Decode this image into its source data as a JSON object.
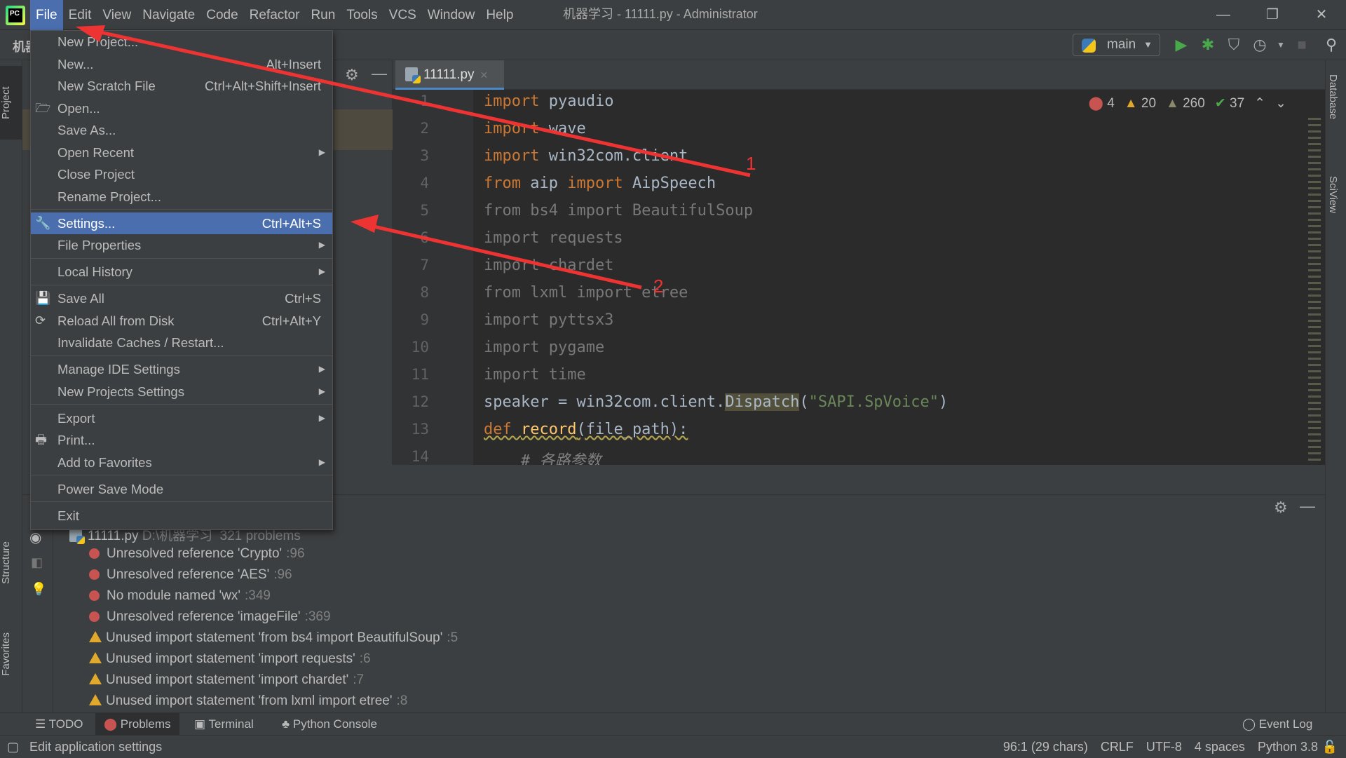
{
  "window": {
    "title": "机器学习 - 11111.py - Administrator",
    "minimize": "—",
    "restore": "❐",
    "close": "✕"
  },
  "menubar": [
    "File",
    "Edit",
    "View",
    "Navigate",
    "Code",
    "Refactor",
    "Run",
    "Tools",
    "VCS",
    "Window",
    "Help"
  ],
  "navbar": {
    "breadcrumb": "机器",
    "run_config": "main"
  },
  "left_tabs": {
    "project": "Project",
    "structure": "Structure",
    "favorites": "Favorites"
  },
  "right_tabs": {
    "database": "Database",
    "sciview": "SciView"
  },
  "editor": {
    "tab": "11111.py",
    "inspections": {
      "errors": "4",
      "warnings": "20",
      "weak_warnings": "260",
      "typos": "37"
    },
    "lines": [
      {
        "n": "1",
        "tokens": [
          {
            "t": "import ",
            "k": "kw"
          },
          {
            "t": "pyaudio",
            "k": "id"
          }
        ]
      },
      {
        "n": "2",
        "tokens": [
          {
            "t": "import ",
            "k": "kw"
          },
          {
            "t": "wave",
            "k": "id"
          }
        ]
      },
      {
        "n": "3",
        "tokens": [
          {
            "t": "import ",
            "k": "kw"
          },
          {
            "t": "win32com.client",
            "k": "id"
          }
        ]
      },
      {
        "n": "4",
        "tokens": [
          {
            "t": "from ",
            "k": "kw"
          },
          {
            "t": "aip ",
            "k": "id"
          },
          {
            "t": "import ",
            "k": "kw"
          },
          {
            "t": "AipSpeech",
            "k": "id"
          }
        ]
      },
      {
        "n": "5",
        "tokens": [
          {
            "t": "from bs4 import BeautifulSoup",
            "k": "dim"
          }
        ]
      },
      {
        "n": "6",
        "tokens": [
          {
            "t": "import requests",
            "k": "dim"
          }
        ]
      },
      {
        "n": "7",
        "tokens": [
          {
            "t": "import chardet",
            "k": "dim"
          }
        ]
      },
      {
        "n": "8",
        "tokens": [
          {
            "t": "from lxml import etree",
            "k": "dim"
          }
        ]
      },
      {
        "n": "9",
        "tokens": [
          {
            "t": "import pyttsx3",
            "k": "dim"
          }
        ]
      },
      {
        "n": "10",
        "tokens": [
          {
            "t": "import pygame",
            "k": "dim"
          }
        ]
      },
      {
        "n": "11",
        "tokens": [
          {
            "t": "import time",
            "k": "dim"
          }
        ]
      },
      {
        "n": "12",
        "tokens": [
          {
            "t": "speaker = win32com.client.",
            "k": "id"
          },
          {
            "t": "Dispatch",
            "k": "hl"
          },
          {
            "t": "(",
            "k": "id"
          },
          {
            "t": "\"SAPI.SpVoice\"",
            "k": "str"
          },
          {
            "t": ")",
            "k": "id"
          }
        ]
      },
      {
        "n": "13",
        "tokens": [
          {
            "t": "def ",
            "k": "kw wavy"
          },
          {
            "t": "record",
            "k": "fn wavy"
          },
          {
            "t": "(file_path):",
            "k": "id wavy"
          }
        ]
      },
      {
        "n": "14",
        "tokens": [
          {
            "t": "    # 各路参数",
            "k": "cm"
          }
        ]
      }
    ]
  },
  "file_menu": [
    {
      "label": "New Project..."
    },
    {
      "label": "New...",
      "shortcut": "Alt+Insert"
    },
    {
      "label": "New Scratch File",
      "shortcut": "Ctrl+Alt+Shift+Insert"
    },
    {
      "label": "Open...",
      "icon": "folder"
    },
    {
      "label": "Save As..."
    },
    {
      "label": "Open Recent",
      "submenu": true
    },
    {
      "label": "Close Project"
    },
    {
      "label": "Rename Project..."
    },
    {
      "sep": true
    },
    {
      "label": "Settings...",
      "shortcut": "Ctrl+Alt+S",
      "icon": "wrench",
      "selected": true
    },
    {
      "label": "File Properties",
      "submenu": true
    },
    {
      "sep": true
    },
    {
      "label": "Local History",
      "submenu": true
    },
    {
      "sep": true
    },
    {
      "label": "Save All",
      "shortcut": "Ctrl+S",
      "icon": "save"
    },
    {
      "label": "Reload All from Disk",
      "shortcut": "Ctrl+Alt+Y",
      "icon": "reload"
    },
    {
      "label": "Invalidate Caches / Restart..."
    },
    {
      "sep": true
    },
    {
      "label": "Manage IDE Settings",
      "submenu": true
    },
    {
      "label": "New Projects Settings",
      "submenu": true
    },
    {
      "sep": true
    },
    {
      "label": "Export",
      "submenu": true
    },
    {
      "label": "Print...",
      "icon": "print"
    },
    {
      "label": "Add to Favorites",
      "submenu": true
    },
    {
      "sep": true
    },
    {
      "label": "Power Save Mode"
    },
    {
      "sep": true
    },
    {
      "label": "Exit"
    }
  ],
  "problems": {
    "file": "11111.py",
    "path": "D:\\机器学习",
    "count": "321 problems",
    "items": [
      {
        "type": "error",
        "text": "Unresolved reference 'Crypto'",
        "line": ":96"
      },
      {
        "type": "error",
        "text": "Unresolved reference 'AES'",
        "line": ":96"
      },
      {
        "type": "error",
        "text": "No module named 'wx'",
        "line": ":349"
      },
      {
        "type": "error",
        "text": "Unresolved reference 'imageFile'",
        "line": ":369"
      },
      {
        "type": "warning",
        "text": "Unused import statement 'from bs4 import BeautifulSoup'",
        "line": ":5"
      },
      {
        "type": "warning",
        "text": "Unused import statement 'import requests'",
        "line": ":6"
      },
      {
        "type": "warning",
        "text": "Unused import statement 'import chardet'",
        "line": ":7"
      },
      {
        "type": "warning",
        "text": "Unused import statement 'from lxml import etree'",
        "line": ":8"
      }
    ]
  },
  "bottom_tabs": {
    "todo": "TODO",
    "problems": "Problems",
    "terminal": "Terminal",
    "python_console": "Python Console",
    "event_log": "Event Log"
  },
  "status": {
    "message": "Edit application settings",
    "position": "96:1 (29 chars)",
    "line_sep": "CRLF",
    "encoding": "UTF-8",
    "indent": "4 spaces",
    "interpreter": "Python 3.8"
  },
  "annotations": {
    "label1": "1",
    "label2": "2",
    "color": "#ee3333"
  },
  "colors": {
    "accent": "#4b6eaf",
    "keyword": "#cc7832",
    "string": "#6a8759",
    "function": "#ffc66d",
    "error": "#c75450",
    "warning": "#e0a82c"
  }
}
